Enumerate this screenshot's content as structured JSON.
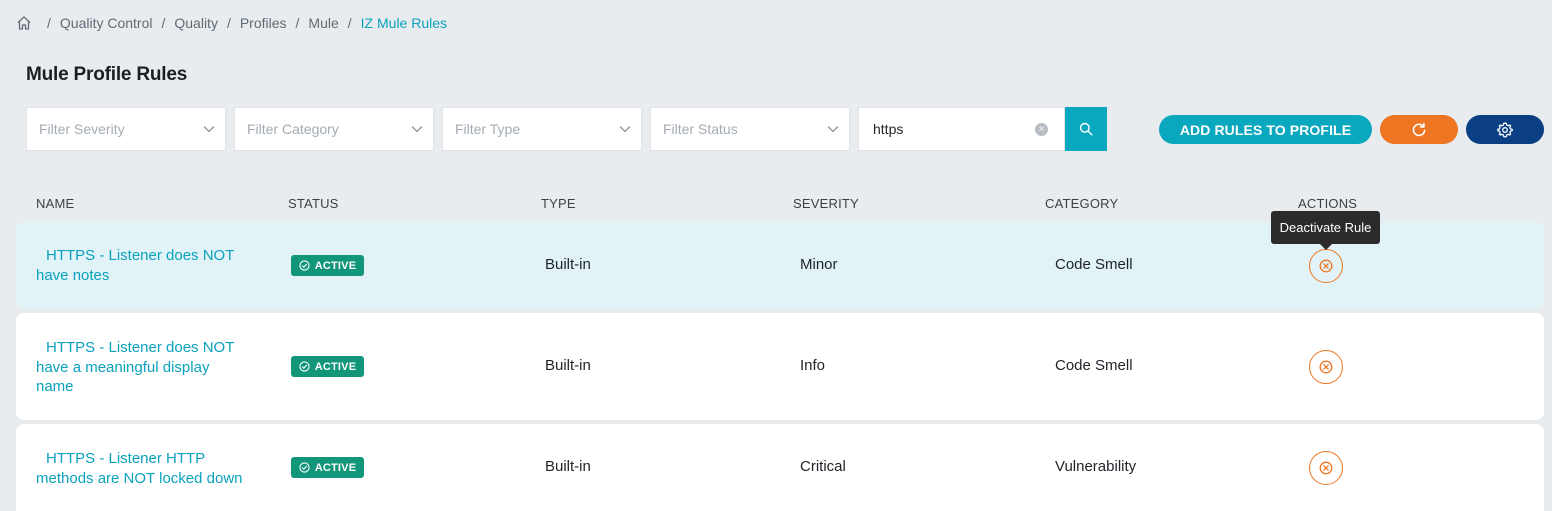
{
  "breadcrumb": {
    "items": [
      "Quality Control",
      "Quality",
      "Profiles",
      "Mule",
      "IZ Mule Rules"
    ]
  },
  "page": {
    "title": "Mule Profile Rules"
  },
  "filters": {
    "severity_placeholder": "Filter Severity",
    "category_placeholder": "Filter Category",
    "type_placeholder": "Filter Type",
    "status_placeholder": "Filter Status",
    "search_value": "https"
  },
  "toolbar": {
    "add_rules_label": "ADD RULES TO PROFILE"
  },
  "table": {
    "headers": {
      "name": "NAME",
      "status": "STATUS",
      "type": "TYPE",
      "severity": "SEVERITY",
      "category": "CATEGORY",
      "actions": "ACTIONS"
    },
    "rows": [
      {
        "name": "HTTPS - Listener does NOT have notes",
        "status": "ACTIVE",
        "type": "Built-in",
        "severity": "Minor",
        "category": "Code Smell"
      },
      {
        "name": "HTTPS - Listener does NOT have a meaningful display name",
        "status": "ACTIVE",
        "type": "Built-in",
        "severity": "Info",
        "category": "Code Smell"
      },
      {
        "name": "HTTPS - Listener HTTP methods are NOT locked down",
        "status": "ACTIVE",
        "type": "Built-in",
        "severity": "Critical",
        "category": "Vulnerability"
      }
    ]
  },
  "tooltip": {
    "text": "Deactivate Rule"
  },
  "colors": {
    "accent": "#0aa8bf",
    "orange": "#ee7623",
    "navy": "#0b3f84",
    "active_badge": "#11967a",
    "row_highlight": "#e1f3f7"
  }
}
